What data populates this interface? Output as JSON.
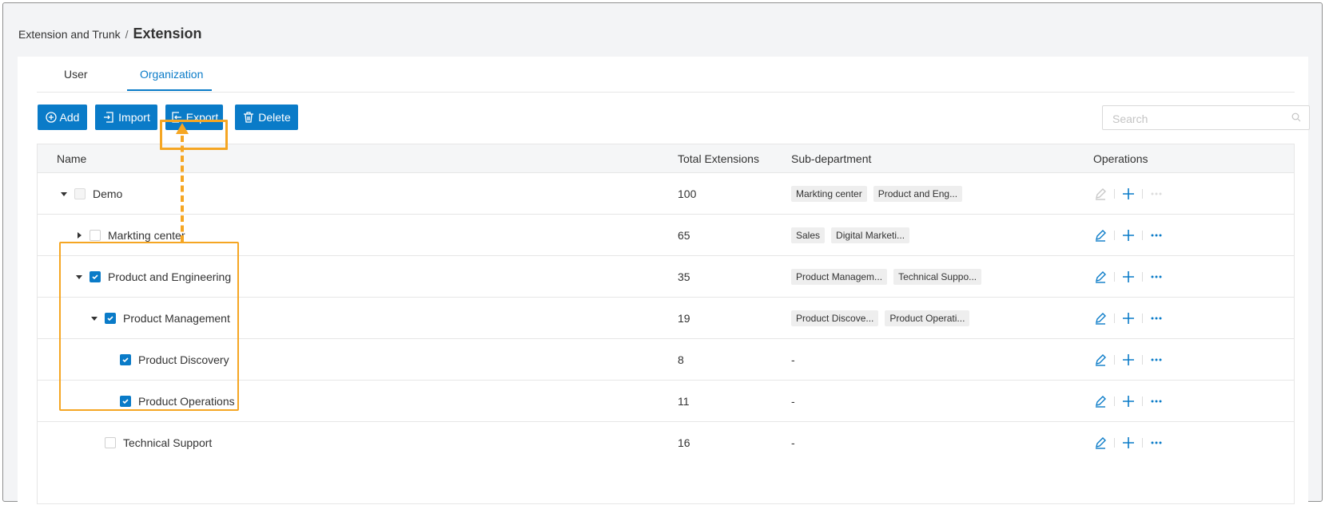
{
  "breadcrumb": {
    "parent": "Extension and Trunk",
    "separator": "/",
    "current": "Extension"
  },
  "tabs": [
    {
      "label": "User"
    },
    {
      "label": "Organization",
      "active": true
    }
  ],
  "toolbar": {
    "add_label": "Add",
    "import_label": "Import",
    "export_label": "Export",
    "delete_label": "Delete"
  },
  "search": {
    "placeholder": "Search",
    "value": ""
  },
  "colors": {
    "accent": "#0a7bc8",
    "highlight": "#f5a623",
    "header_bg": "#f5f6f7",
    "tag_bg": "#eeeeee"
  },
  "table": {
    "columns": {
      "name": "Name",
      "total": "Total Extensions",
      "sub": "Sub-department",
      "ops": "Operations"
    },
    "rows": [
      {
        "name": "Demo",
        "total": "100",
        "subs": [
          "Markting center",
          "Product and Eng..."
        ],
        "sub_text": "",
        "checked": false,
        "expand": "expanded",
        "edit_disabled": true
      },
      {
        "name": "Markting center",
        "total": "65",
        "subs": [
          "Sales",
          "Digital Marketi..."
        ],
        "sub_text": "",
        "checked": false,
        "expand": "collapsed",
        "edit_disabled": false
      },
      {
        "name": "Product and Engineering",
        "total": "35",
        "subs": [
          "Product Managem...",
          "Technical Suppo..."
        ],
        "sub_text": "",
        "checked": true,
        "expand": "expanded",
        "edit_disabled": false
      },
      {
        "name": "Product Management",
        "total": "19",
        "subs": [
          "Product Discove...",
          "Product Operati..."
        ],
        "sub_text": "",
        "checked": true,
        "expand": "expanded",
        "edit_disabled": false
      },
      {
        "name": "Product Discovery",
        "total": "8",
        "subs": [],
        "sub_text": "-",
        "checked": true,
        "expand": "none",
        "edit_disabled": false
      },
      {
        "name": "Product Operations",
        "total": "11",
        "subs": [],
        "sub_text": "-",
        "checked": true,
        "expand": "none",
        "edit_disabled": false
      },
      {
        "name": "Technical Support",
        "total": "16",
        "subs": [],
        "sub_text": "-",
        "checked": false,
        "expand": "none",
        "edit_disabled": false
      }
    ]
  }
}
